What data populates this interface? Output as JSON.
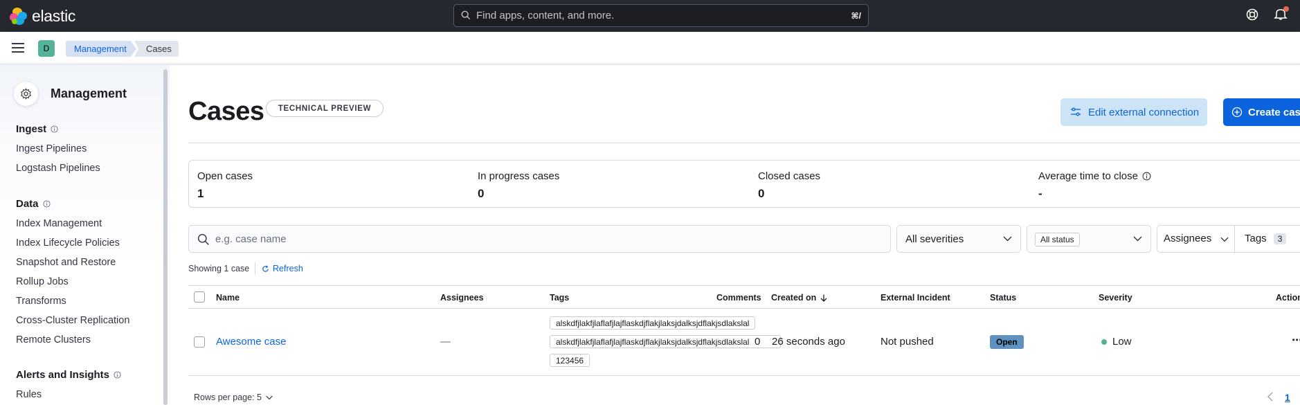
{
  "app": {
    "name": "elastic"
  },
  "search": {
    "placeholder": "Find apps, content, and more.",
    "shortcut": "⌘/"
  },
  "space": {
    "initial": "D"
  },
  "breadcrumbs": [
    "Management",
    "Cases"
  ],
  "sidebar": {
    "title": "Management",
    "sections": [
      {
        "title": "Ingest",
        "items": [
          "Ingest Pipelines",
          "Logstash Pipelines"
        ]
      },
      {
        "title": "Data",
        "items": [
          "Index Management",
          "Index Lifecycle Policies",
          "Snapshot and Restore",
          "Rollup Jobs",
          "Transforms",
          "Cross-Cluster Replication",
          "Remote Clusters"
        ]
      },
      {
        "title": "Alerts and Insights",
        "items": [
          "Rules"
        ]
      }
    ]
  },
  "page": {
    "title": "Cases",
    "badge": "TECHNICAL PREVIEW",
    "edit_button": "Edit external connection",
    "create_button": "Create case"
  },
  "stats": [
    {
      "label": "Open cases",
      "value": "1"
    },
    {
      "label": "In progress cases",
      "value": "0"
    },
    {
      "label": "Closed cases",
      "value": "0"
    },
    {
      "label": "Average time to close",
      "value": "-"
    }
  ],
  "filters": {
    "search_placeholder": "e.g. case name",
    "severity": "All severities",
    "status": "All status",
    "assignees": "Assignees",
    "tags": "Tags",
    "tags_count": "3"
  },
  "toolbar": {
    "showing": "Showing 1 case",
    "refresh": "Refresh"
  },
  "table": {
    "columns": [
      "Name",
      "Assignees",
      "Tags",
      "Comments",
      "Created on",
      "External Incident",
      "Status",
      "Severity",
      "Actions"
    ],
    "rows": [
      {
        "name": "Awesome case",
        "assignees": "—",
        "tags": [
          "alskdfjlakfjlaflafjlajflaskdjflakjlaksjdalksjdflakjsdlakslal",
          "alskdfjlakfjlaflafjlajflaskdjflakjlaksjdalksjdflakjsdlakslal",
          "123456"
        ],
        "comments": "0",
        "created_on": "26 seconds ago",
        "external_incident": "Not pushed",
        "status": "Open",
        "severity": "Low"
      }
    ]
  },
  "pagination": {
    "rows_per_page": "Rows per page: 5",
    "current_page": "1"
  },
  "colors": {
    "header_bg": "#25282f",
    "primary": "#0b64dd",
    "status_open": "#6092c0",
    "severity_low": "#54b399"
  }
}
